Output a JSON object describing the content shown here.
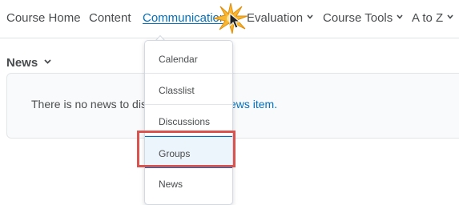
{
  "nav": {
    "items": [
      {
        "label": "Course Home",
        "has_dropdown": false
      },
      {
        "label": "Content",
        "has_dropdown": false
      },
      {
        "label": "Communication",
        "has_dropdown": true,
        "active": true
      },
      {
        "label": "Evaluation",
        "has_dropdown": true
      },
      {
        "label": "Course Tools",
        "has_dropdown": true
      },
      {
        "label": "A to Z",
        "has_dropdown": true
      }
    ]
  },
  "dropdown": {
    "items": [
      {
        "label": "Calendar"
      },
      {
        "label": "Classlist"
      },
      {
        "label": "Discussions"
      },
      {
        "label": "Groups",
        "selected": true,
        "highlighted": true
      },
      {
        "label": "News"
      }
    ]
  },
  "news": {
    "heading": "News",
    "message_start": "There is no news to dis",
    "message_link": "ews item."
  },
  "colors": {
    "link": "#006fbf",
    "text": "#494c4e",
    "highlight_box": "#d9534f",
    "selected_bg": "#ecf5fb"
  },
  "icons": {
    "dropdown": "chevron-down-icon",
    "cursor": "mouse-pointer-icon",
    "click": "click-burst-icon"
  }
}
